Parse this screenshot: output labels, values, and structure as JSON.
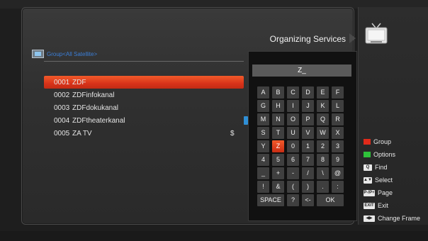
{
  "header": {
    "title": "Organizing Services",
    "group_label": "Group<All Satellite>"
  },
  "channels": [
    {
      "number": "0001",
      "name": "ZDF",
      "scrambled": "",
      "selected": true
    },
    {
      "number": "0002",
      "name": "ZDFinfokanal",
      "scrambled": "",
      "selected": false
    },
    {
      "number": "0003",
      "name": "ZDFdokukanal",
      "scrambled": "",
      "selected": false
    },
    {
      "number": "0004",
      "name": "ZDFtheaterkanal",
      "scrambled": "",
      "selected": false
    },
    {
      "number": "0005",
      "name": "ZA TV",
      "scrambled": "$",
      "selected": false
    }
  ],
  "keyboard": {
    "input_value": "Z_",
    "rows": [
      [
        "A",
        "B",
        "C",
        "D",
        "E",
        "F"
      ],
      [
        "G",
        "H",
        "I",
        "J",
        "K",
        "L"
      ],
      [
        "M",
        "N",
        "O",
        "P",
        "Q",
        "R"
      ],
      [
        "S",
        "T",
        "U",
        "V",
        "W",
        "X"
      ],
      [
        "Y",
        "Z",
        "0",
        "1",
        "2",
        "3"
      ],
      [
        "4",
        "5",
        "6",
        "7",
        "8",
        "9"
      ],
      [
        "_",
        "+",
        "-",
        "/",
        "\\",
        "@"
      ],
      [
        "!",
        "&",
        "(",
        ")",
        ".",
        ":"
      ]
    ],
    "bottom": {
      "space": "SPACE",
      "question": "?",
      "backspace": "<-",
      "ok": "OK"
    },
    "active_key": "Z"
  },
  "legend": {
    "group": "Group",
    "options": "Options",
    "find": "Find",
    "select": "Select",
    "page": "Page",
    "exit": "Exit",
    "change_frame": "Change Frame",
    "icon_labels": {
      "find": "Q",
      "select": "▲▼",
      "page": "P-/P+",
      "exit": "EXIT",
      "change_frame": "◀▶"
    },
    "colors": {
      "group": "#e02a1a",
      "options": "#2fc23a"
    }
  },
  "colors": {
    "highlight": "#e0401e",
    "group_text": "#3b7fd9"
  },
  "icons": {
    "tv": "tv-icon",
    "group": "satellite-group-icon"
  }
}
